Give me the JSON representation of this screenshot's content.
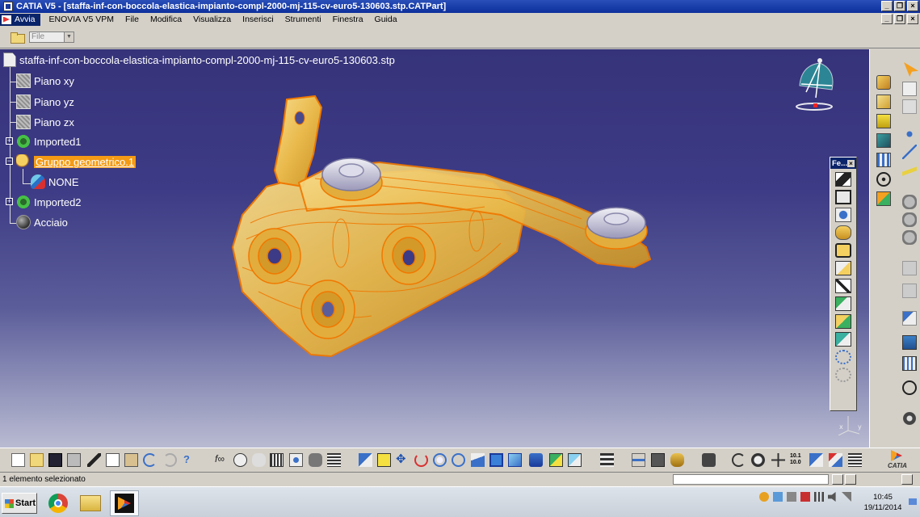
{
  "window": {
    "title": "CATIA V5 - [staffa-inf-con-boccola-elastica-impianto-compl-2000-mj-115-cv-euro5-130603.stp.CATPart]"
  },
  "menu": {
    "start_label": "Avvia",
    "items": [
      "ENOVIA V5 VPM",
      "File",
      "Modifica",
      "Visualizza",
      "Inserisci",
      "Strumenti",
      "Finestra",
      "Guida"
    ]
  },
  "file_combo": {
    "value": "File"
  },
  "tree": {
    "root": "staffa-inf-con-boccola-elastica-impianto-compl-2000-mj-115-cv-euro5-130603.stp",
    "nodes": [
      {
        "label": "Piano xy",
        "icon": "plane-icon"
      },
      {
        "label": "Piano yz",
        "icon": "plane-icon"
      },
      {
        "label": "Piano zx",
        "icon": "plane-icon"
      },
      {
        "label": "Imported1",
        "icon": "gear-icon"
      },
      {
        "label": "Gruppo geometrico.1",
        "icon": "hand-icon",
        "selected": true
      },
      {
        "label": "NONE",
        "icon": "none-icon"
      },
      {
        "label": "Imported2",
        "icon": "gear-icon"
      },
      {
        "label": "Acciaio",
        "icon": "material-icon"
      }
    ]
  },
  "floating_toolbar": {
    "title": "Fe...",
    "close": "×"
  },
  "status": {
    "message": "1 elemento selezionato"
  },
  "logo": "CATIA",
  "taskbar": {
    "start_label": "Start",
    "time": "10:45",
    "date": "19/11/2014"
  },
  "colors": {
    "viewport_top": "#36337a",
    "part_fill": "#e9b94b",
    "part_edge": "#f07800",
    "selection": "#f49a14"
  }
}
